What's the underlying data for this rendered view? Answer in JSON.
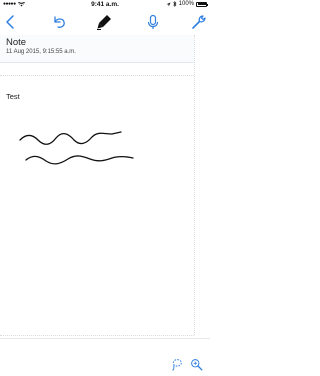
{
  "status_bar": {
    "carrier_dots": "●●●●●",
    "time": "9:41 a.m.",
    "battery_percent": "100%"
  },
  "toolbar": {
    "back_icon": "chevron-left-icon",
    "undo_icon": "undo-icon",
    "pen_icon": "pen-icon",
    "mic_icon": "microphone-icon",
    "settings_icon": "wrench-icon",
    "accent_color": "#2f7fe0"
  },
  "note": {
    "title": "Note",
    "date": "11 Aug 2015, 9:15:55 a.m.",
    "text": "Test"
  },
  "bottom_toolbar": {
    "lasso_icon": "lasso-icon",
    "zoom_icon": "zoom-in-icon"
  }
}
